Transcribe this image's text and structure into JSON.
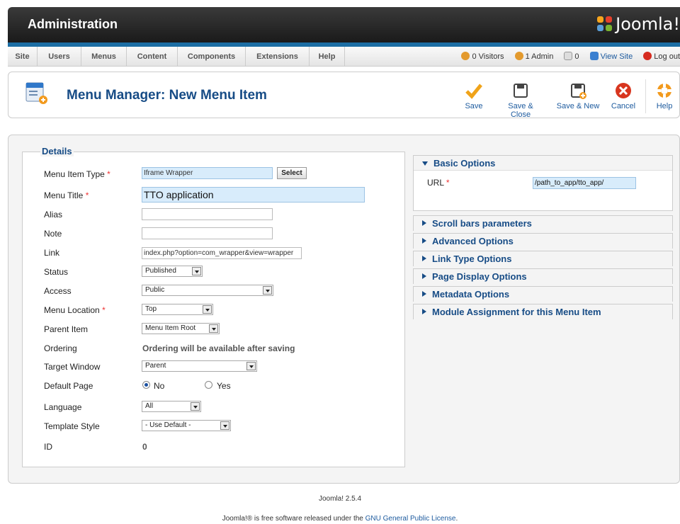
{
  "header": {
    "title": "Administration",
    "logo_text": "Joomla!"
  },
  "menu": {
    "items": [
      "Site",
      "Users",
      "Menus",
      "Content",
      "Components",
      "Extensions",
      "Help"
    ]
  },
  "status": {
    "visitors": "0 Visitors",
    "admins": "1 Admin",
    "messages": "0",
    "view_site": "View Site",
    "logout": "Log out"
  },
  "toolbar": {
    "page_title": "Menu Manager: New Menu Item",
    "save": "Save",
    "save_close": "Save & Close",
    "save_new": "Save & New",
    "cancel": "Cancel",
    "help": "Help"
  },
  "details": {
    "legend": "Details",
    "menu_item_type_label": "Menu Item Type",
    "menu_item_type_value": "Iframe Wrapper",
    "select_button": "Select",
    "menu_title_label": "Menu Title",
    "menu_title_value": "TTO application",
    "alias_label": "Alias",
    "alias_value": "",
    "note_label": "Note",
    "note_value": "",
    "link_label": "Link",
    "link_value": "index.php?option=com_wrapper&view=wrapper",
    "status_label": "Status",
    "status_value": "Published",
    "access_label": "Access",
    "access_value": "Public",
    "menu_location_label": "Menu Location",
    "menu_location_value": "Top",
    "parent_item_label": "Parent Item",
    "parent_item_value": "Menu Item Root",
    "ordering_label": "Ordering",
    "ordering_value": "Ordering will be available after saving",
    "target_window_label": "Target Window",
    "target_window_value": "Parent",
    "default_page_label": "Default Page",
    "default_no": "No",
    "default_yes": "Yes",
    "language_label": "Language",
    "language_value": "All",
    "template_style_label": "Template Style",
    "template_style_value": "- Use Default -",
    "id_label": "ID",
    "id_value": "0",
    "required_mark": "*"
  },
  "options": {
    "basic": "Basic Options",
    "url_label": "URL",
    "url_value": "/path_to_app/tto_app/",
    "scroll": "Scroll bars parameters",
    "advanced": "Advanced Options",
    "link_type": "Link Type Options",
    "page_display": "Page Display Options",
    "metadata": "Metadata Options",
    "module_assignment": "Module Assignment for this Menu Item"
  },
  "footer": {
    "version": "Joomla! 2.5.4",
    "license_prefix": "Joomla!® is free software released under the ",
    "license_link": "GNU General Public License",
    "license_suffix": "."
  },
  "colors": {
    "accent": "#174c86",
    "header_bg": "#1a1a1a",
    "blue_bar": "#1c6ea4"
  }
}
